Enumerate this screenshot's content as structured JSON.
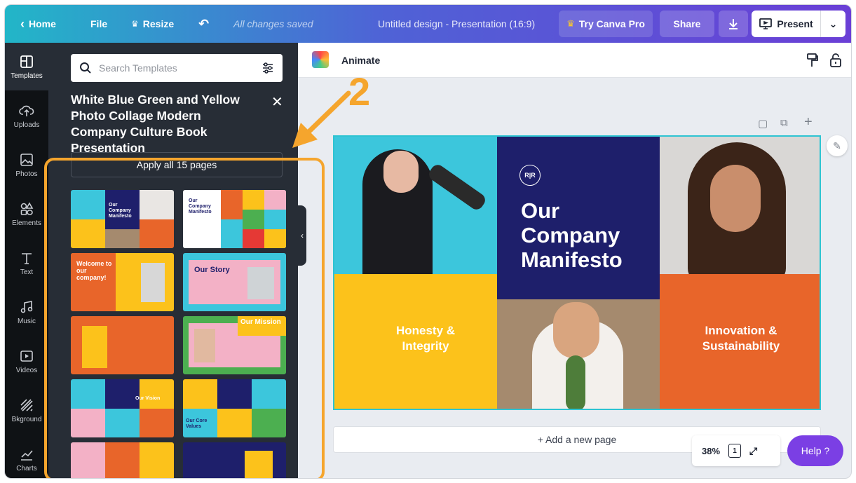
{
  "topbar": {
    "home": "Home",
    "file": "File",
    "resize": "Resize",
    "saved": "All changes saved",
    "title": "Untitled design - Presentation (16:9)",
    "try_pro": "Try Canva Pro",
    "share": "Share",
    "present": "Present"
  },
  "rail": [
    {
      "label": "Templates",
      "icon": "templates-icon"
    },
    {
      "label": "Uploads",
      "icon": "upload-icon"
    },
    {
      "label": "Photos",
      "icon": "photos-icon"
    },
    {
      "label": "Elements",
      "icon": "elements-icon"
    },
    {
      "label": "Text",
      "icon": "text-icon"
    },
    {
      "label": "Music",
      "icon": "music-icon"
    },
    {
      "label": "Videos",
      "icon": "video-icon"
    },
    {
      "label": "Bkground",
      "icon": "background-icon"
    },
    {
      "label": "Charts",
      "icon": "charts-icon"
    }
  ],
  "panel": {
    "search_placeholder": "Search Templates",
    "title": "White Blue Green and Yellow Photo Collage Modern Company Culture Book Presentation",
    "apply": "Apply all 15 pages",
    "thumbs": [
      {
        "text": "Our Company Manifesto"
      },
      {
        "text": "Our Company Manifesto"
      },
      {
        "text": "Welcome to our company!"
      },
      {
        "text": "Our Story"
      },
      {
        "text": ""
      },
      {
        "text": "Our Mission"
      },
      {
        "text": "Our Vision"
      },
      {
        "text": "Our Core Values"
      },
      {
        "text": ""
      },
      {
        "text": ""
      }
    ]
  },
  "annotation": {
    "step": "2"
  },
  "toolbar": {
    "animate": "Animate"
  },
  "slide": {
    "logo": "R|R",
    "heading": "Our Company Manifesto",
    "left_text": "Honesty & Integrity",
    "right_text": "Innovation & Sustainability"
  },
  "canvas": {
    "add_page": "+ Add a new page",
    "zoom": "38%",
    "page_count": "1",
    "help": "Help ?"
  },
  "colors": {
    "accent": "#7b3fe4",
    "annotation": "#f5a52d",
    "slide_blue": "#1e1f6b",
    "slide_yellow": "#fcc21b",
    "slide_orange": "#e8652a"
  }
}
